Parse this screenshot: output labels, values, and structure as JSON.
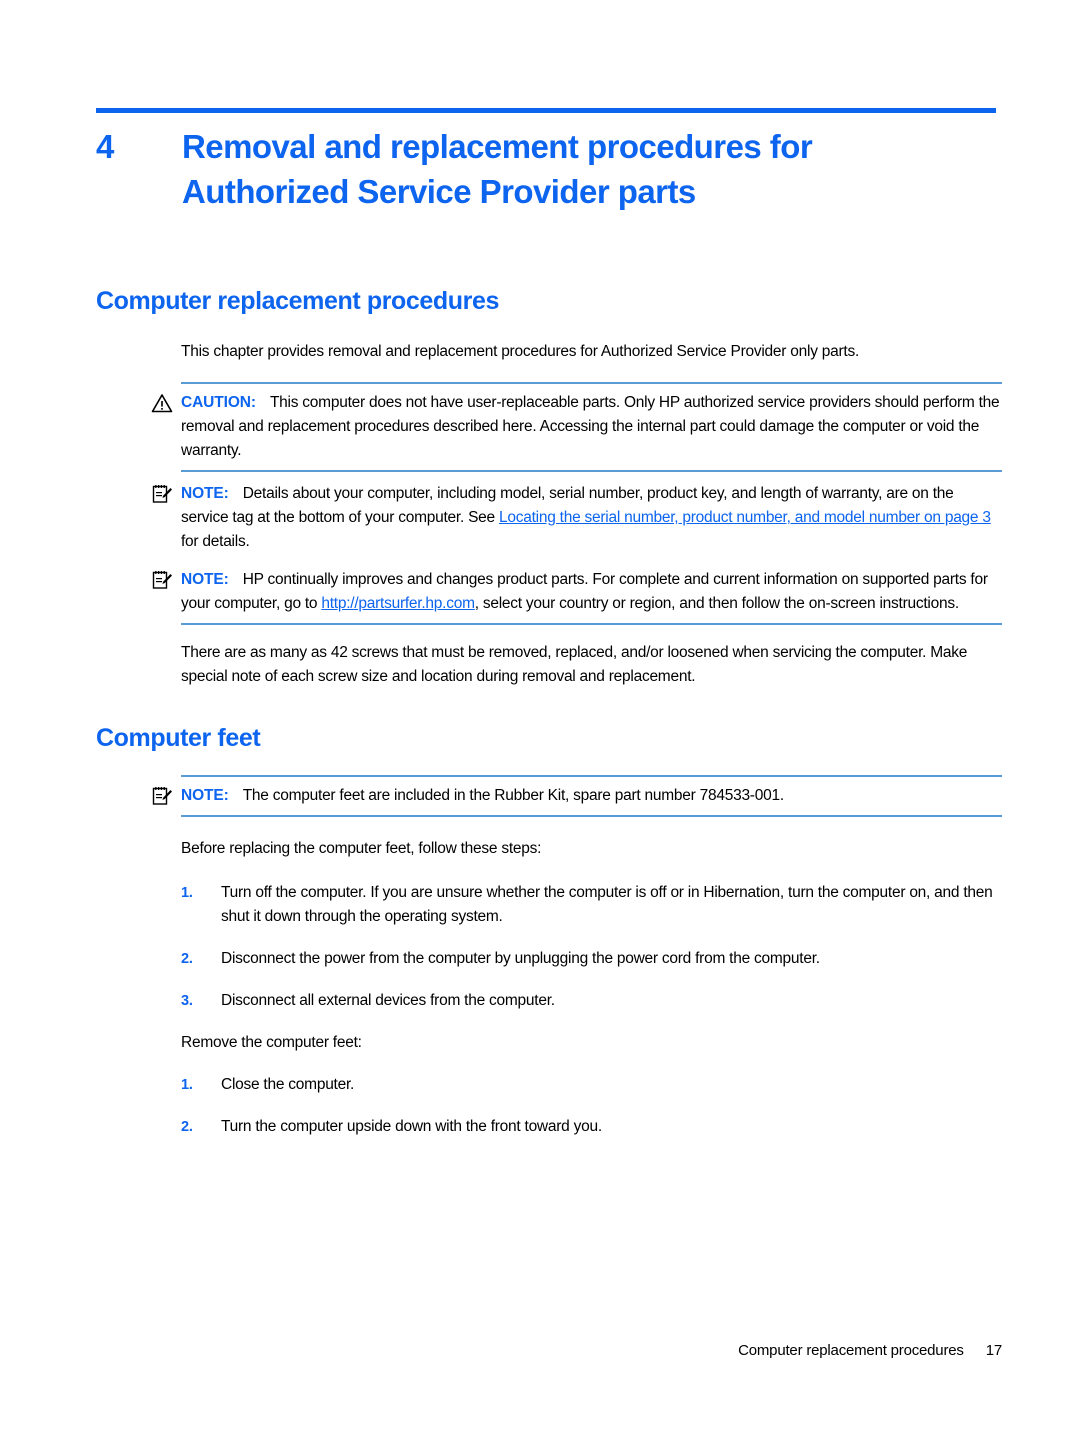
{
  "chapter": {
    "number": "4",
    "title": "Removal and replacement procedures for Authorized Service Provider parts"
  },
  "sections": {
    "replacement_procedures": {
      "heading": "Computer replacement procedures",
      "intro": "This chapter provides removal and replacement procedures for Authorized Service Provider only parts.",
      "caution": {
        "icon": "warning-triangle-icon",
        "label": "CAUTION:",
        "text": "This computer does not have user-replaceable parts. Only HP authorized service providers should perform the removal and replacement procedures described here. Accessing the internal part could damage the computer or void the warranty."
      },
      "note_service_tag": {
        "icon": "note-pad-icon",
        "label": "NOTE:",
        "text_before": "Details about your computer, including model, serial number, product key, and length of warranty, are on the service tag at the bottom of your computer. See ",
        "link_text": "Locating the serial number, product number, and model number on page 3",
        "text_after": " for details."
      },
      "note_partsurfer": {
        "icon": "note-pad-icon",
        "label": "NOTE:",
        "text_before": "HP continually improves and changes product parts. For complete and current information on supported parts for your computer, go to ",
        "link_text": "http://partsurfer.hp.com",
        "text_after": ", select your country or region, and then follow the on-screen instructions."
      },
      "screws_paragraph": "There are as many as 42 screws that must be removed, replaced, and/or loosened when servicing the computer. Make special note of each screw size and location during removal and replacement."
    },
    "computer_feet": {
      "heading": "Computer feet",
      "note_rubber_kit": {
        "icon": "note-pad-icon",
        "label": "NOTE:",
        "text": "The computer feet are included in the Rubber Kit, spare part number 784533-001."
      },
      "before_intro": "Before replacing the computer feet, follow these steps:",
      "before_steps": [
        {
          "num": "1.",
          "text": "Turn off the computer. If you are unsure whether the computer is off or in Hibernation, turn the computer on, and then shut it down through the operating system."
        },
        {
          "num": "2.",
          "text": "Disconnect the power from the computer by unplugging the power cord from the computer."
        },
        {
          "num": "3.",
          "text": "Disconnect all external devices from the computer."
        }
      ],
      "remove_intro": "Remove the computer feet:",
      "remove_steps": [
        {
          "num": "1.",
          "text": "Close the computer."
        },
        {
          "num": "2.",
          "text": "Turn the computer upside down with the front toward you."
        }
      ]
    }
  },
  "footer": {
    "text": "Computer replacement procedures",
    "page_number": "17"
  },
  "colors": {
    "accent_blue": "#0C64EF",
    "rule_blue": "#5B9BD5",
    "text_black": "#000000"
  }
}
